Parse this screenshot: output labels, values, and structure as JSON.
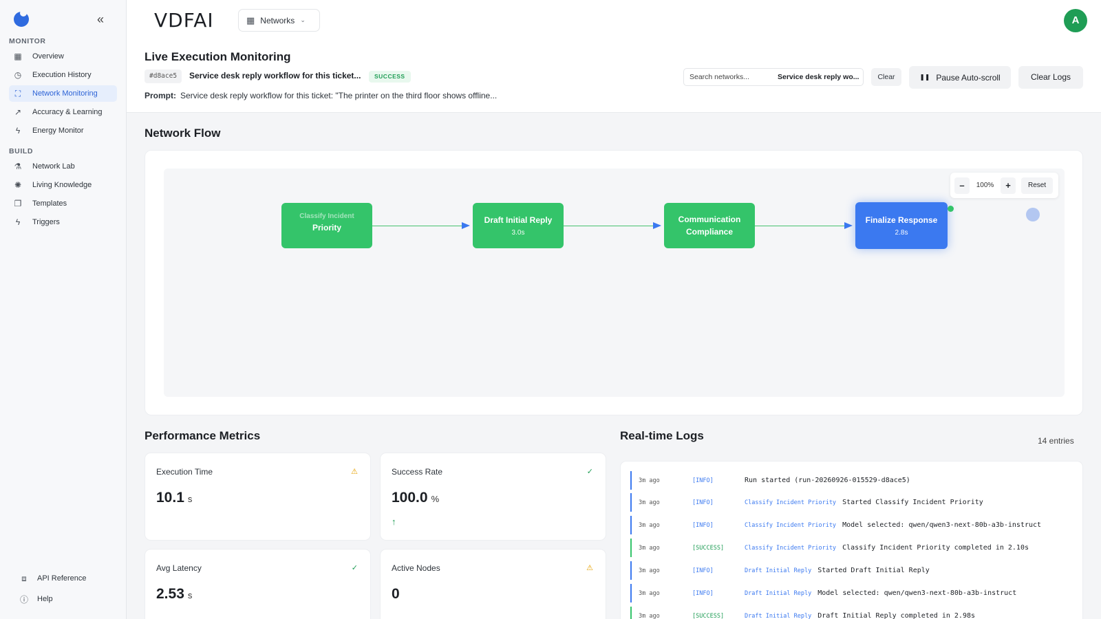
{
  "sidebar": {
    "sections": [
      {
        "title": "MONITOR",
        "items": [
          {
            "label": "Overview",
            "icon": "grid-icon"
          },
          {
            "label": "Execution History",
            "icon": "history-icon"
          },
          {
            "label": "Network Monitoring",
            "icon": "network-icon",
            "active": true
          },
          {
            "label": "Accuracy & Learning",
            "icon": "trend-icon"
          },
          {
            "label": "Energy Monitor",
            "icon": "bolt-icon"
          }
        ]
      },
      {
        "title": "BUILD",
        "items": [
          {
            "label": "Network Lab",
            "icon": "flask-icon"
          },
          {
            "label": "Living Knowledge",
            "icon": "brain-icon"
          },
          {
            "label": "Templates",
            "icon": "document-icon"
          },
          {
            "label": "Triggers",
            "icon": "bolt-icon"
          }
        ]
      }
    ],
    "footer": [
      {
        "label": "API Reference",
        "icon": "code-icon"
      },
      {
        "label": "Help",
        "icon": "help-icon"
      }
    ]
  },
  "header": {
    "brand": "VDFAI",
    "networks_label": "Networks",
    "avatar_initial": "A"
  },
  "run": {
    "title": "Live Execution Monitoring",
    "id": "#d8ace5",
    "name": "Service desk reply workflow for this ticket...",
    "status": "SUCCESS",
    "prompt_label": "Prompt:",
    "prompt": "Service desk reply workflow for this ticket: \"The printer on the third floor shows offline..."
  },
  "controls": {
    "search_placeholder": "Search networks...",
    "search_selected": "Service desk reply wo...",
    "clear": "Clear",
    "pause": "Pause Auto-scroll",
    "clear_logs": "Clear Logs"
  },
  "flow": {
    "heading": "Network Flow",
    "zoom": "100%",
    "zoom_minus": "–",
    "zoom_plus": "+",
    "reset": "Reset",
    "nodes": [
      {
        "label": "Priority",
        "ghost": "Classify Incident",
        "duration": "",
        "status": "success"
      },
      {
        "label": "Draft Initial Reply",
        "duration": "3.0s",
        "status": "success"
      },
      {
        "label": "Communication Compliance",
        "duration": "",
        "status": "success"
      },
      {
        "label": "Finalize Response",
        "duration": "2.8s",
        "status": "active"
      }
    ]
  },
  "metrics": {
    "heading": "Performance Metrics",
    "cards": [
      {
        "label": "Execution Time",
        "value": "10.1",
        "unit": "s",
        "badge": "warning"
      },
      {
        "label": "Success Rate",
        "value": "100.0",
        "unit": "%",
        "badge": "ok",
        "trend": "↑"
      },
      {
        "label": "Avg Latency",
        "value": "2.53",
        "unit": "s",
        "badge": "ok"
      },
      {
        "label": "Active Nodes",
        "value": "0",
        "unit": "",
        "badge": "warning"
      }
    ]
  },
  "logs": {
    "heading": "Real-time Logs",
    "count": "14 entries",
    "entries": [
      {
        "time": "3m ago",
        "level": "[INFO]",
        "node": "",
        "message": "Run started (run-20260926-015529-d8ace5)"
      },
      {
        "time": "3m ago",
        "level": "[INFO]",
        "node": "Classify Incident Priority",
        "message": "Started Classify Incident Priority"
      },
      {
        "time": "3m ago",
        "level": "[INFO]",
        "node": "Classify Incident Priority",
        "message": "Model selected: qwen/qwen3-next-80b-a3b-instruct"
      },
      {
        "time": "3m ago",
        "level": "[SUCCESS]",
        "node": "Classify Incident Priority",
        "message": "Classify Incident Priority completed in 2.10s"
      },
      {
        "time": "3m ago",
        "level": "[INFO]",
        "node": "Draft Initial Reply",
        "message": "Started Draft Initial Reply"
      },
      {
        "time": "3m ago",
        "level": "[INFO]",
        "node": "Draft Initial Reply",
        "message": "Model selected: qwen/qwen3-next-80b-a3b-instruct"
      },
      {
        "time": "3m ago",
        "level": "[SUCCESS]",
        "node": "Draft Initial Reply",
        "message": "Draft Initial Reply completed in 2.98s"
      }
    ]
  },
  "colors": {
    "accent": "#2f6bdf",
    "success": "#34c46a",
    "warning": "#e6a100"
  }
}
